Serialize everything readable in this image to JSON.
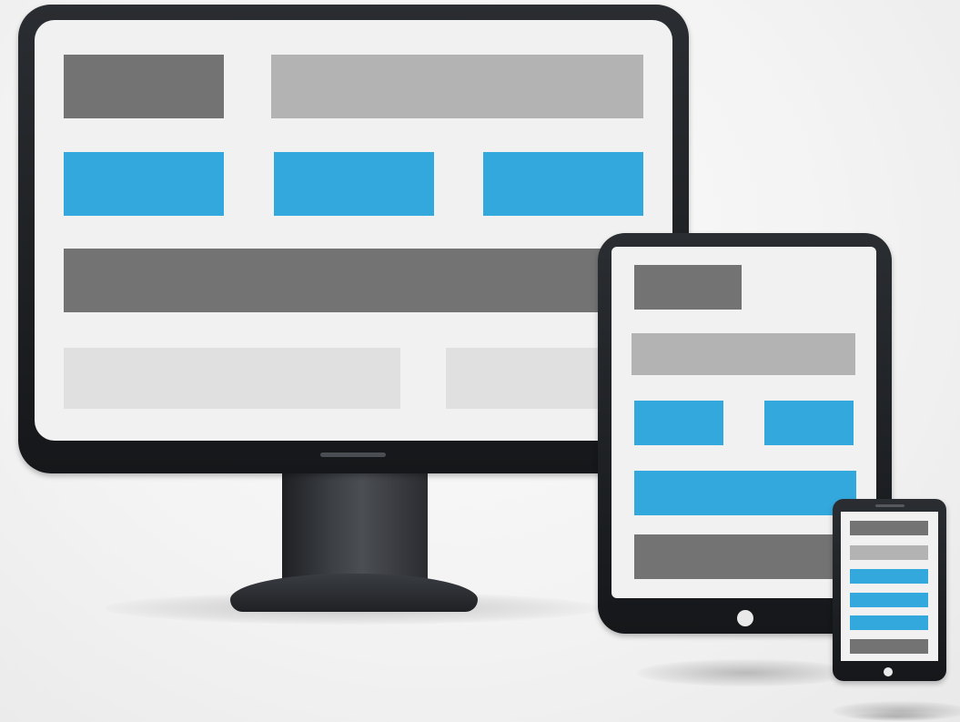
{
  "colors": {
    "background": "#f2f2f2",
    "device_frame": "#1c1e21",
    "screen": "#f1f1f1",
    "block_dark": "#737373",
    "block_mid": "#b3b3b3",
    "block_light": "#e0e0e0",
    "block_blue": "#33a8dd"
  },
  "devices": {
    "monitor": {
      "icon": "desktop-monitor-icon",
      "blocks": [
        "logo",
        "header-bar",
        "feature-1",
        "feature-2",
        "feature-3",
        "content-bar",
        "panel-left",
        "panel-right"
      ]
    },
    "tablet": {
      "icon": "tablet-icon",
      "blocks": [
        "logo",
        "header-bar",
        "feature-1",
        "feature-2",
        "feature-wide",
        "content-bar"
      ]
    },
    "phone": {
      "icon": "smartphone-icon",
      "blocks": [
        "logo",
        "header-bar",
        "feature-1",
        "feature-2",
        "feature-3",
        "content-bar"
      ]
    }
  }
}
